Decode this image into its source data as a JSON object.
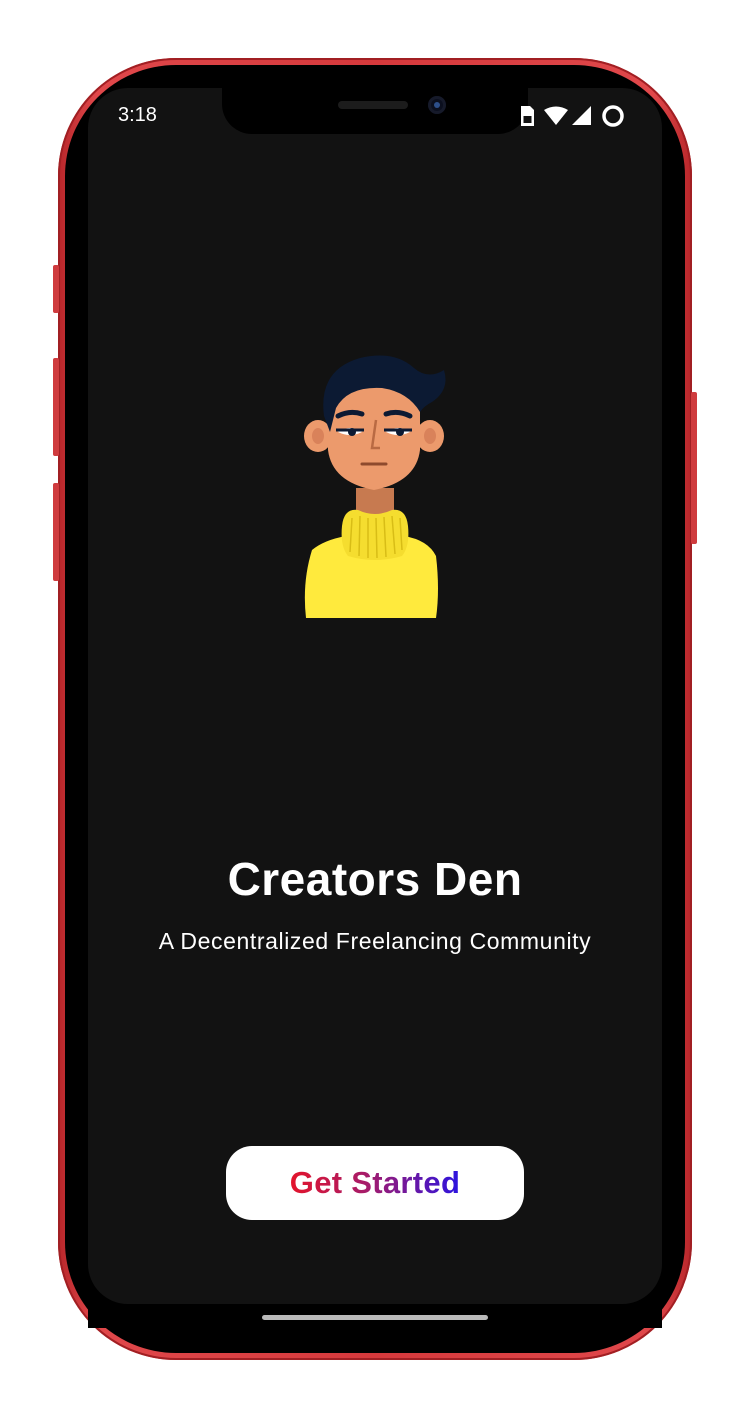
{
  "status_bar": {
    "time": "3:18",
    "icons": [
      "sim-card-icon",
      "wifi-icon",
      "cellular-signal-icon",
      "battery-ring-icon"
    ]
  },
  "hero": {
    "illustration": "person-avatar-illustration",
    "title": "Creators Den",
    "subtitle": "A Decentralized Freelancing Community"
  },
  "actions": {
    "get_started_label": "Get Started"
  },
  "colors": {
    "screen_background": "#121212",
    "frame": "#d6393c",
    "button_background": "#ffffff",
    "button_text_gradient": [
      "#e3142b",
      "#a61c6a",
      "#2b13e0"
    ],
    "avatar_sweater": "#ffea3d",
    "avatar_skin": "#ec9a6c",
    "avatar_hair": "#0c1a33"
  }
}
